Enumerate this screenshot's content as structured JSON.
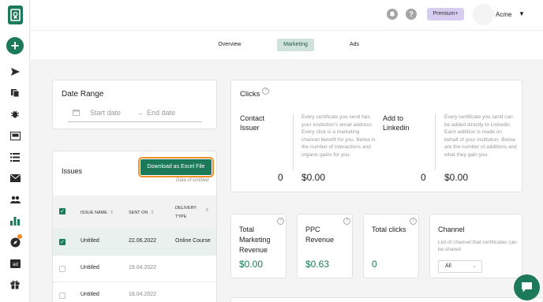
{
  "header": {
    "premium_label": "Premium",
    "premium_suffix": "+",
    "user_name": "Acme",
    "caret": "▼"
  },
  "tabs": [
    {
      "label": "Overview"
    },
    {
      "label": "Marketing"
    },
    {
      "label": "Ads"
    }
  ],
  "date_range": {
    "title": "Date Range",
    "start_placeholder": "Start date",
    "separator": "→",
    "end_placeholder": "End date"
  },
  "issues": {
    "title": "Issues",
    "download_label": "Download as Excel File",
    "data_of": "Data of Untitled",
    "columns": {
      "issue_name": "ISSUE NAME",
      "sent_on": "SENT ON",
      "delivery_type_line1": "DELIVERY",
      "delivery_type_line2": "TYPE"
    },
    "rows": [
      {
        "name": "Untitled",
        "sent_on": "22.06.2022",
        "delivery": "Online Course",
        "selected": true
      },
      {
        "name": "Untitled",
        "sent_on": "19.04.2022",
        "delivery": "",
        "selected": false
      },
      {
        "name": "Untitled",
        "sent_on": "18.04.2022",
        "delivery": "",
        "selected": false
      }
    ]
  },
  "clicks": {
    "title": "Clicks",
    "contact": {
      "label_line1": "Contact",
      "label_line2": "Issuer",
      "description": "Every certificate you send has your institution's email address. Every click is a marketing channel benefit for you. Below is the number of interactions and organic gains for you.",
      "count": "0",
      "value": "$0.00"
    },
    "linkedin": {
      "label_line1": "Add to",
      "label_line2": "Linkedin",
      "description": "Every certificate you send can be added directly to Linkedin. Each addition is made on behalf of your institution. Below are the number of additions and what they gain you.",
      "count": "0",
      "value": "$0.00"
    }
  },
  "metrics": {
    "total_marketing": {
      "line1": "Total",
      "line2": "Marketing",
      "line3": "Revenue",
      "value": "$0.00"
    },
    "ppc": {
      "line1": "PPC",
      "line2": "Revenue",
      "value": "$0.63"
    },
    "total_clicks": {
      "label": "Total clicks",
      "value": "0"
    },
    "channel": {
      "title": "Channel",
      "description": "List of channel that certificates can be shared",
      "selected": "All"
    }
  },
  "colors": {
    "brand": "#1c7a5a",
    "highlight": "#f0922c",
    "premium_bg": "#d7cdf0"
  }
}
